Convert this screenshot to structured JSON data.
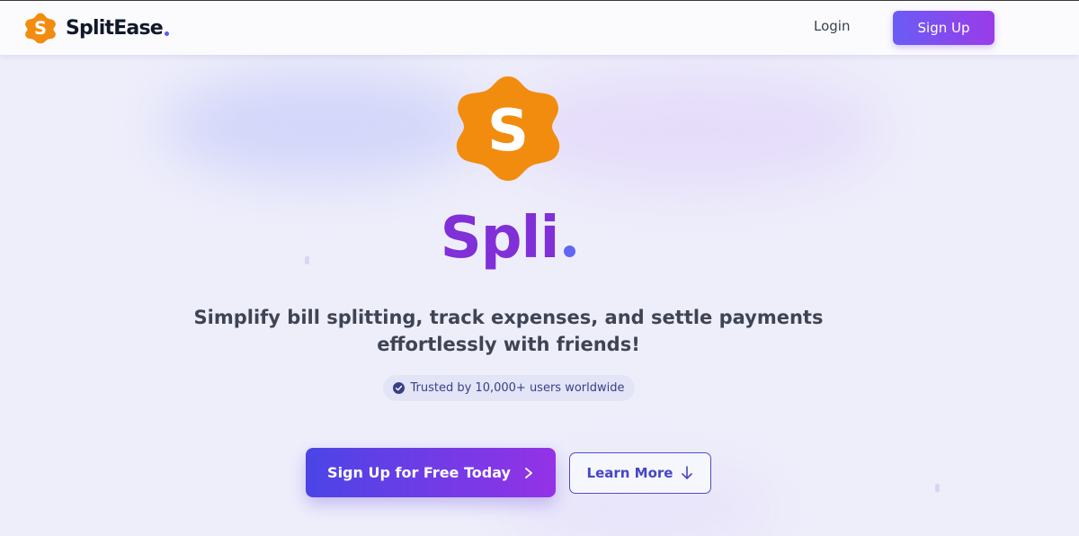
{
  "brand": {
    "name": "SplitEase",
    "logo_letter": "S",
    "logo_icon": "splitease-logo-icon",
    "accent_color": "#f28c0f"
  },
  "nav": {
    "login_label": "Login",
    "signup_label": "Sign Up"
  },
  "hero": {
    "logo_icon": "splitease-logo-icon",
    "logo_letter": "S",
    "title": "Spli",
    "tagline_line1": "Simplify bill splitting, track expenses, and settle payments",
    "tagline_line2": "effortlessly with friends!",
    "trust_badge": "Trusted by 10,000+ users worldwide",
    "trust_icon": "check-circle-icon"
  },
  "cta": {
    "primary_label": "Sign Up for Free Today",
    "primary_icon": "chevron-right-icon",
    "secondary_label": "Learn More",
    "secondary_icon": "arrow-down-icon"
  },
  "colors": {
    "primary_gradient_start": "#4b45e6",
    "primary_gradient_end": "#9432e6",
    "title_color": "#8030d6",
    "logo_orange": "#f28c0f",
    "background": "#eeeefb"
  }
}
